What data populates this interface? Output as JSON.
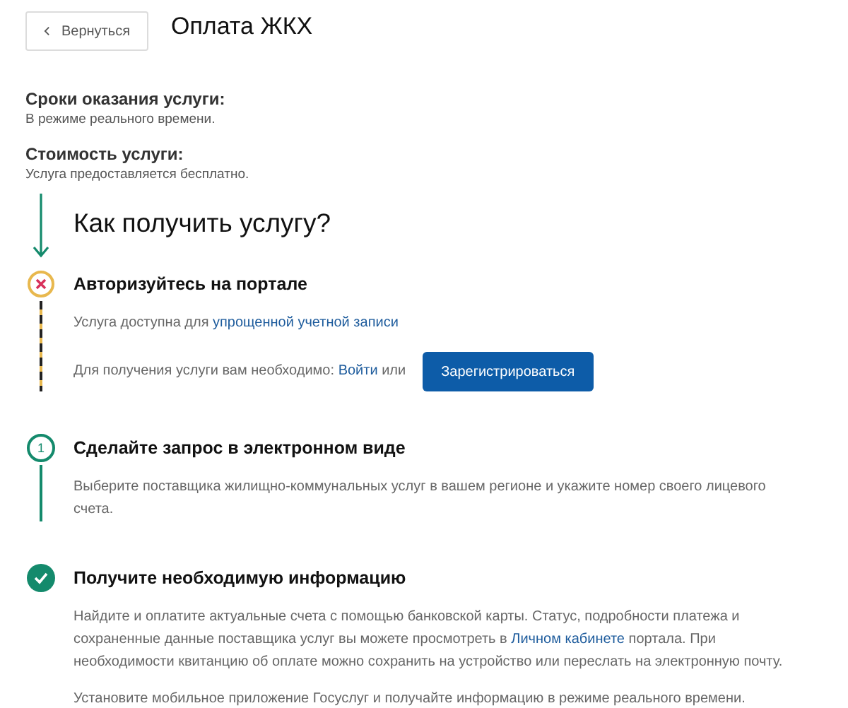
{
  "back_button": {
    "label": "Вернуться"
  },
  "title": "Оплата ЖКХ",
  "info": [
    {
      "label": "Сроки оказания услуги:",
      "value": "В режиме реального времени."
    },
    {
      "label": "Стоимость услуги:",
      "value": "Услуга предоставляется бесплатно."
    }
  ],
  "how_to": {
    "heading": "Как получить услугу?",
    "steps": [
      {
        "kind": "error",
        "title": "Авторизуйтесь на портале",
        "paragraphs": [
          [
            {
              "text": "Услуга доступна для "
            },
            {
              "text": "упрощенной учетной записи",
              "link": true
            }
          ]
        ],
        "action": {
          "prefix": [
            {
              "text": "Для получения услуги вам необходимо: "
            },
            {
              "text": "Войти",
              "link": true
            },
            {
              "text": " или"
            }
          ],
          "button": "Зарегистрироваться"
        }
      },
      {
        "kind": "number",
        "marker": "1",
        "title": "Сделайте запрос в электронном виде",
        "paragraphs": [
          [
            {
              "text": "Выберите поставщика жилищно-коммунальных услуг в вашем регионе и укажите номер своего лицевого счета."
            }
          ]
        ]
      },
      {
        "kind": "done",
        "title": "Получите необходимую информацию",
        "paragraphs": [
          [
            {
              "text": "Найдите и оплатите актуальные счета с помощью банковской карты. Статус, подробности платежа и сохраненные данные поставщика услуг вы можете просмотреть в "
            },
            {
              "text": "Личном кабинете",
              "link": true
            },
            {
              "text": " портала. При необходимости квитанцию об оплате можно сохранить на устройство или переслать на электронную почту."
            }
          ],
          [
            {
              "text": "Установите мобильное приложение Госуслуг и получайте информацию в режиме реального времени."
            }
          ]
        ]
      }
    ]
  }
}
